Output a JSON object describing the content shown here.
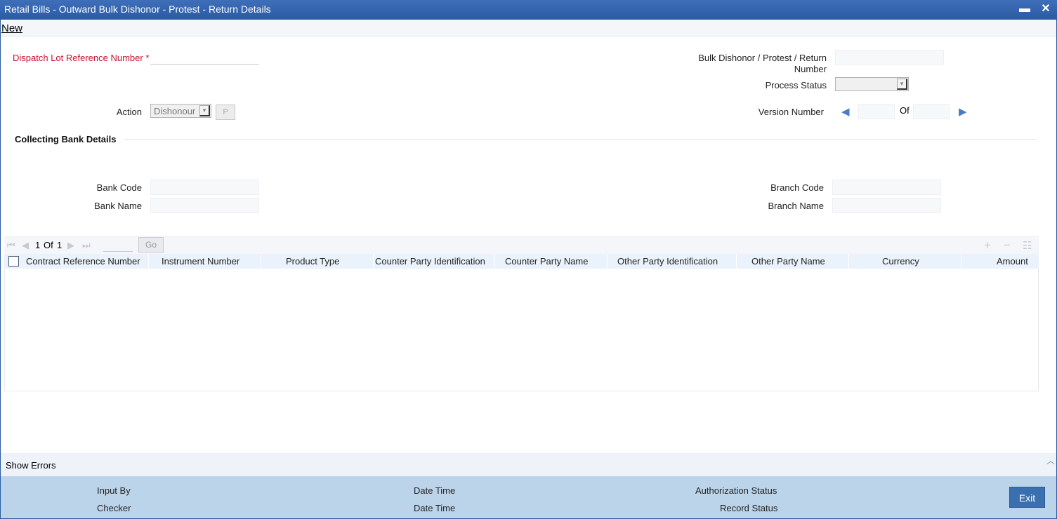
{
  "window": {
    "title": "Retail Bills - Outward Bulk Dishonor - Protest - Return Details",
    "minimize_glyph": "▬",
    "close_glyph": "✕"
  },
  "menu": {
    "new_label": "New"
  },
  "form": {
    "dispatch_lot_label": "Dispatch Lot Reference Number",
    "required_mark": "*",
    "dispatch_lot_value": "",
    "bulk_ref_label_line1": "Bulk Dishonor / Protest / Return",
    "bulk_ref_label_line2": "Number",
    "bulk_ref_value": "",
    "process_status_label": "Process Status",
    "process_status_value": "",
    "action_label": "Action",
    "action_value": "Dishonour",
    "p_button_label": "P",
    "version_label": "Version Number",
    "version_of_label": "Of",
    "version_current": "",
    "version_total": ""
  },
  "collecting_bank": {
    "section_title": "Collecting Bank Details",
    "bank_code_label": "Bank Code",
    "bank_name_label": "Bank Name",
    "branch_code_label": "Branch Code",
    "branch_name_label": "Branch Name",
    "bank_code_value": "",
    "bank_name_value": "",
    "branch_code_value": "",
    "branch_name_value": ""
  },
  "grid": {
    "pager_current": "1",
    "pager_of": "Of",
    "pager_total": "1",
    "go_label": "Go",
    "columns": [
      "Contract Reference Number",
      "Instrument Number",
      "Product Type",
      "Counter Party Identification",
      "Counter Party Name",
      "Other Party Identification",
      "Other Party Name",
      "Currency",
      "Amount"
    ],
    "rows": []
  },
  "footer": {
    "show_errors_label": "Show Errors",
    "input_by_label": "Input By",
    "checker_label": "Checker",
    "date_time_label_1": "Date Time",
    "date_time_label_2": "Date Time",
    "authorization_status_label": "Authorization Status",
    "record_status_label": "Record Status",
    "exit_label": "Exit"
  },
  "colors": {
    "titlebar": "#2a5aa3",
    "required_label": "#c8102e",
    "footer_bg": "#bcd4ea",
    "exit_button": "#3a6fb0"
  }
}
